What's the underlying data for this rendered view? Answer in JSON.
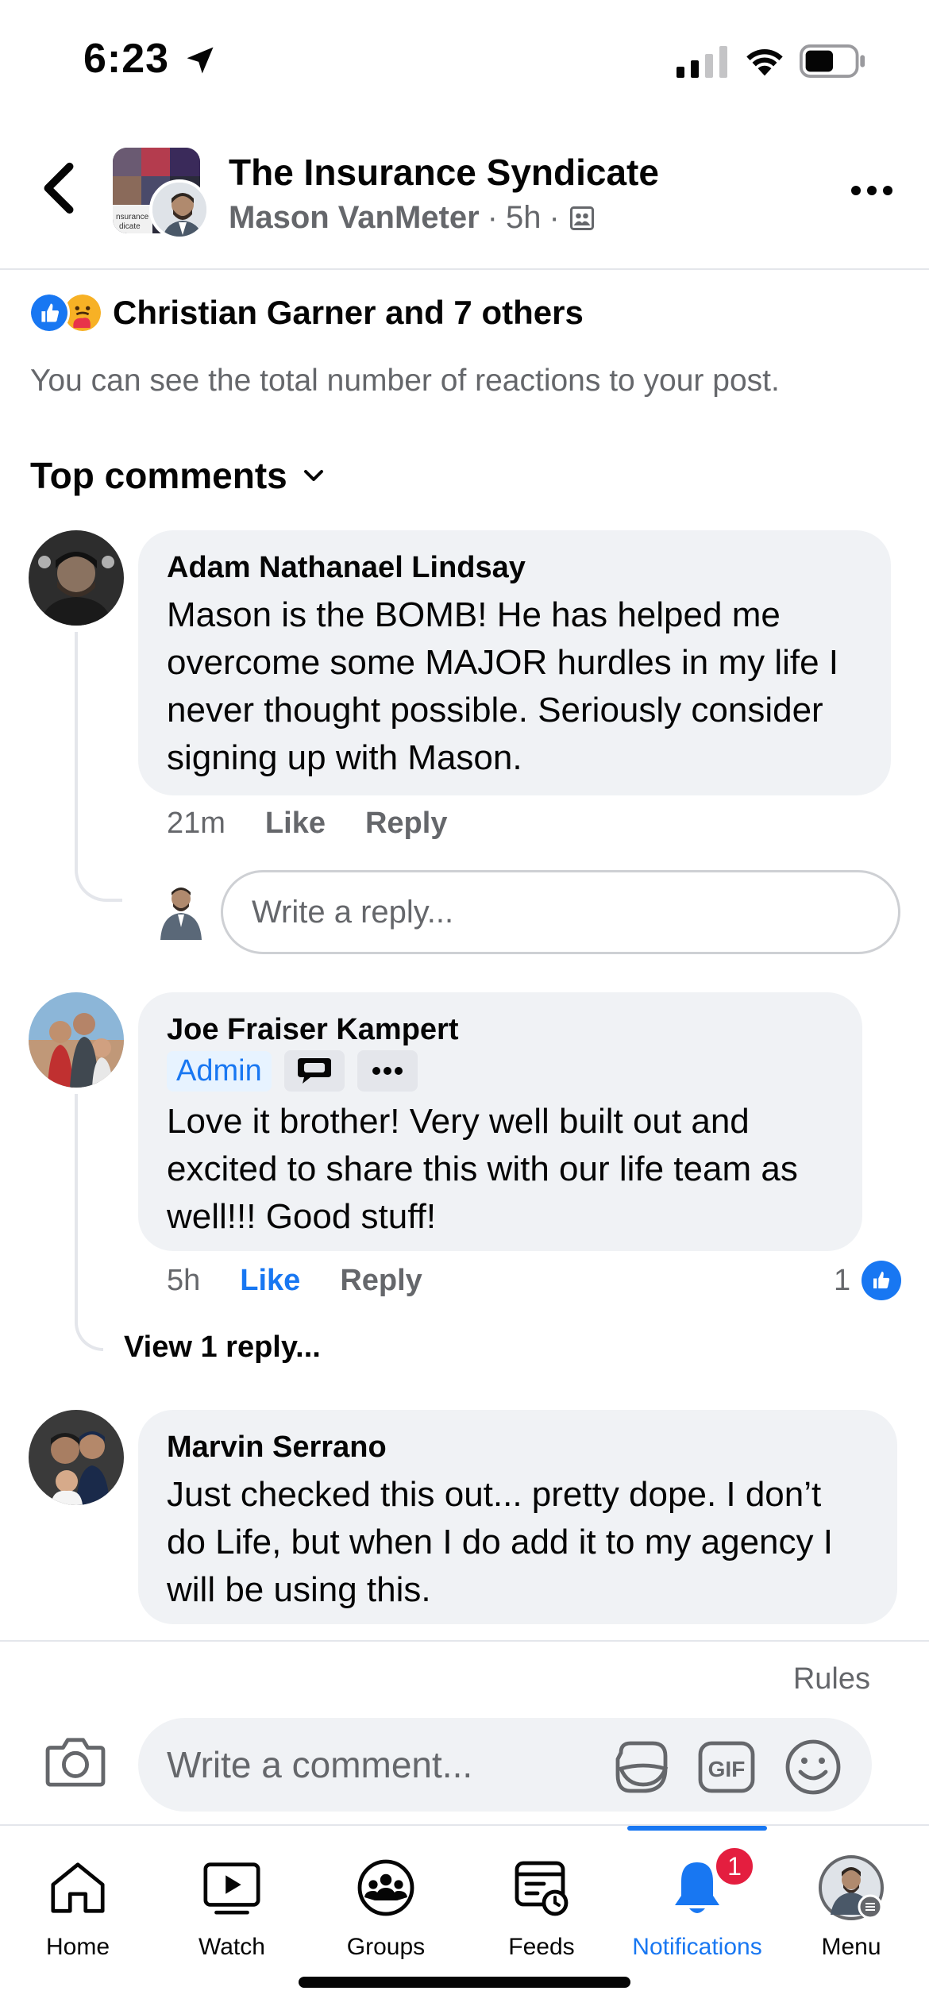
{
  "status_bar": {
    "time": "6:23"
  },
  "header": {
    "group_name": "The Insurance Syndicate",
    "author": "Mason VanMeter",
    "time": "5h"
  },
  "reactions": {
    "summary": "Christian Garner and 7 others",
    "info": "You can see the total number of reactions to your post."
  },
  "comments_header": {
    "label": "Top comments"
  },
  "comments": [
    {
      "name": "Adam Nathanael Lindsay",
      "lines": [
        "Mason is the BOMB! He has helped me",
        "overcome some MAJOR hurdles in my life I",
        "never thought possible. Seriously consider",
        "signing up with Mason."
      ],
      "time": "21m",
      "like_label": "Like",
      "reply_label": "Reply",
      "reply_placeholder": "Write a reply..."
    },
    {
      "name": "Joe Fraiser Kampert",
      "badge": "Admin",
      "lines": [
        "Love it brother! Very well built out and",
        "excited to share this with our life team as",
        "well!!! Good stuff!"
      ],
      "time": "5h",
      "like_label": "Like",
      "reply_label": "Reply",
      "like_count": "1",
      "view_replies": "View 1 reply..."
    },
    {
      "name": "Marvin Serrano",
      "lines": [
        "Just checked this out... pretty dope. I don’t",
        "do Life, but when I do add it to my agency I",
        "will be using this."
      ]
    }
  ],
  "composer": {
    "rules_label": "Rules",
    "placeholder": "Write a comment..."
  },
  "tabbar": {
    "tabs": [
      {
        "label": "Home"
      },
      {
        "label": "Watch"
      },
      {
        "label": "Groups"
      },
      {
        "label": "Feeds"
      },
      {
        "label": "Notifications",
        "badge": "1"
      },
      {
        "label": "Menu"
      }
    ]
  },
  "colors": {
    "accent": "#1877f2",
    "badge_red": "#e41e3f",
    "bubble": "#f0f2f5",
    "muted": "#65676b"
  }
}
